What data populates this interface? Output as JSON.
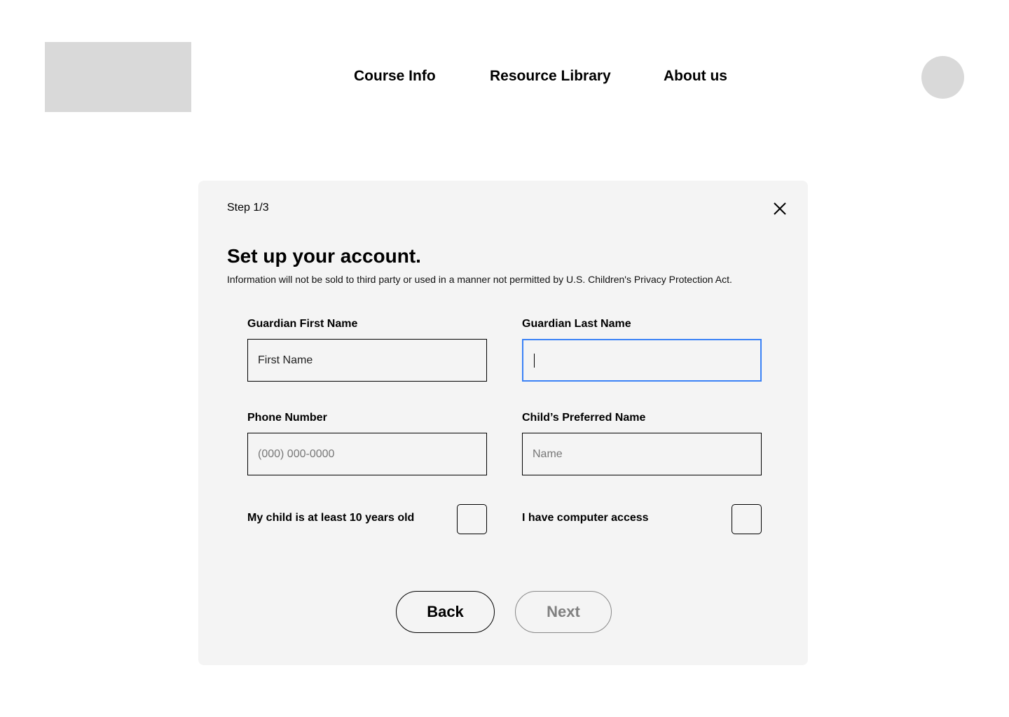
{
  "nav": {
    "links": [
      "Course Info",
      "Resource Library",
      "About us"
    ]
  },
  "modal": {
    "step": "Step 1/3",
    "title": "Set up your account.",
    "subtitle": "Information will not be sold to third party or used in a manner not permitted by U.S. Children's Privacy Protection Act.",
    "fields": {
      "first_name": {
        "label": "Guardian First Name",
        "placeholder": "First Name"
      },
      "last_name": {
        "label": "Guardian Last Name",
        "value": ""
      },
      "phone": {
        "label": "Phone Number",
        "placeholder": "(000) 000-0000"
      },
      "child_name": {
        "label": "Child’s Preferred Name",
        "placeholder": "Name"
      }
    },
    "checkboxes": {
      "age": {
        "label": "My child is at least 10 years old",
        "checked": false
      },
      "computer": {
        "label": "I have computer access",
        "checked": false
      }
    },
    "back_label": "Back",
    "next_label": "Next"
  }
}
